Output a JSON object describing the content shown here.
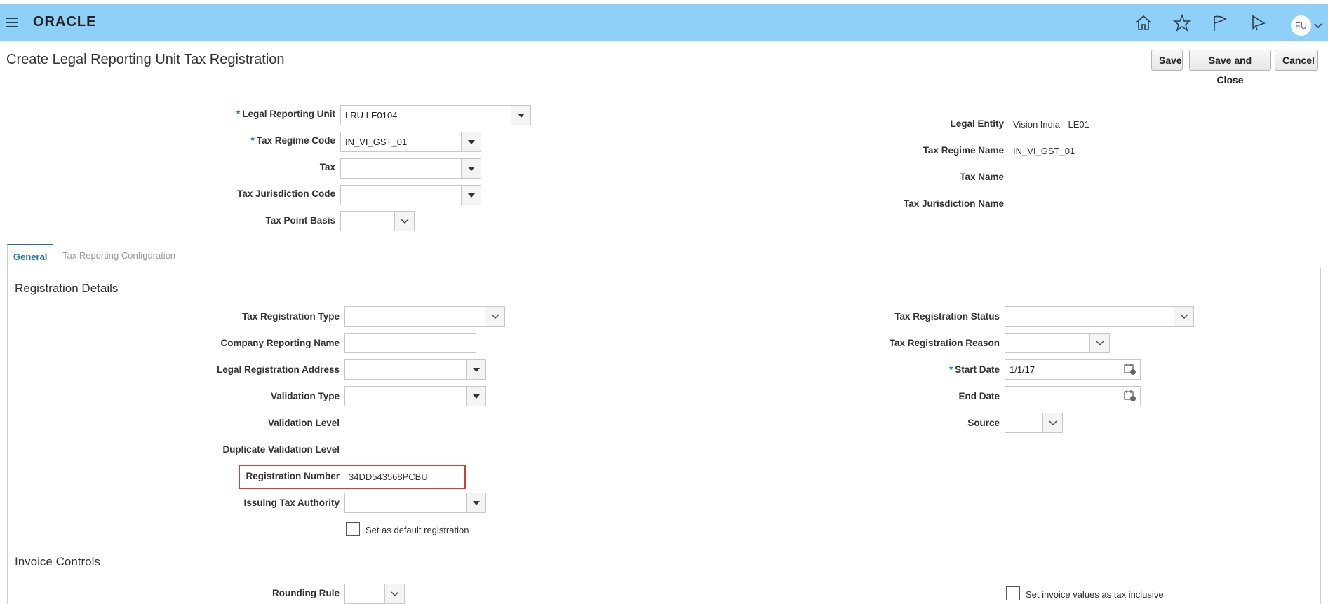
{
  "header": {
    "brand": "ORACLE",
    "avatar_initials": "FU",
    "icons": [
      "menu-icon",
      "home-icon",
      "star-icon",
      "flag-icon",
      "notification-icon",
      "avatar",
      "chevron-down-icon"
    ]
  },
  "page": {
    "title": "Create Legal Reporting Unit Tax Registration",
    "buttons": {
      "save": "Save",
      "save_close": "Save and Close",
      "cancel": "Cancel"
    }
  },
  "top_form": {
    "legal_reporting_unit": {
      "label": "Legal Reporting Unit",
      "required": "*",
      "value": "LRU LE0104"
    },
    "tax_regime_code": {
      "label": "Tax Regime Code",
      "required": "*",
      "value": "IN_VI_GST_01"
    },
    "tax": {
      "label": "Tax",
      "value": ""
    },
    "tax_jurisdiction_code": {
      "label": "Tax Jurisdiction Code",
      "value": ""
    },
    "tax_point_basis": {
      "label": "Tax Point Basis",
      "value": ""
    },
    "legal_entity": {
      "label": "Legal Entity",
      "value": "Vision India - LE01"
    },
    "tax_regime_name": {
      "label": "Tax Regime Name",
      "value": "IN_VI_GST_01"
    },
    "tax_name": {
      "label": "Tax Name",
      "value": ""
    },
    "tax_jurisdiction_name": {
      "label": "Tax Jurisdiction Name",
      "value": ""
    }
  },
  "tabs": [
    {
      "label": "General",
      "active": true
    },
    {
      "label": "Tax Reporting Configuration",
      "active": false
    }
  ],
  "registration_details": {
    "title": "Registration Details",
    "tax_registration_type": {
      "label": "Tax Registration Type",
      "value": ""
    },
    "company_reporting_name": {
      "label": "Company Reporting Name",
      "value": ""
    },
    "legal_registration_address": {
      "label": "Legal Registration Address",
      "value": ""
    },
    "validation_type": {
      "label": "Validation Type",
      "value": ""
    },
    "validation_level": {
      "label": "Validation Level"
    },
    "duplicate_validation_level": {
      "label": "Duplicate Validation Level"
    },
    "registration_number": {
      "label": "Registration Number",
      "value": "34DD543568PCBU"
    },
    "issuing_tax_authority": {
      "label": "Issuing Tax Authority",
      "value": ""
    },
    "set_default": {
      "label": "Set as default registration",
      "checked": false
    },
    "tax_registration_status": {
      "label": "Tax Registration Status",
      "value": ""
    },
    "tax_registration_reason": {
      "label": "Tax Registration Reason",
      "value": ""
    },
    "start_date": {
      "label": "Start Date",
      "required": "*",
      "value": "1/1/17"
    },
    "end_date": {
      "label": "End Date",
      "value": ""
    },
    "source": {
      "label": "Source",
      "value": ""
    }
  },
  "invoice_controls": {
    "title": "Invoice Controls",
    "rounding_rule": {
      "label": "Rounding Rule",
      "value": ""
    },
    "tax_inclusive": {
      "label": "Set invoice values as tax inclusive",
      "checked": false
    }
  },
  "colors": {
    "header_bg": "#8fd0f9",
    "accent": "#1f6fb5",
    "required": "#3a6bb8",
    "highlight": "#d43b3b"
  }
}
